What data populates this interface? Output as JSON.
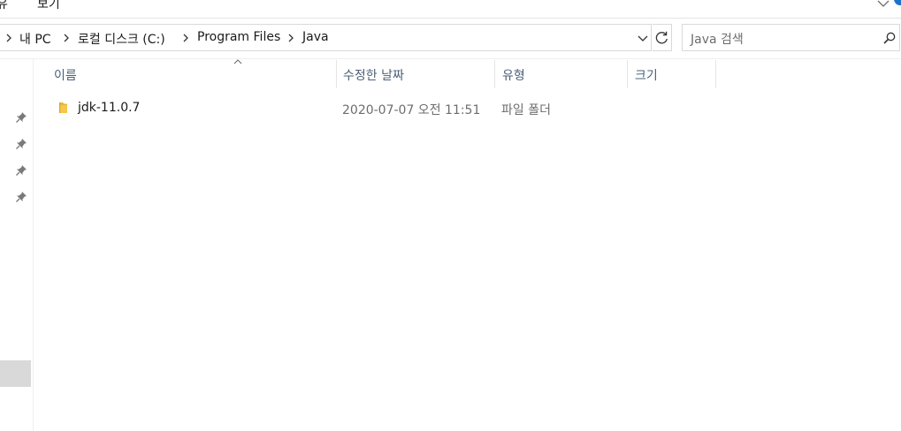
{
  "ribbon": {
    "tab_share": "유",
    "tab_view": "보기"
  },
  "address": {
    "crumbs": [
      {
        "label": "내 PC"
      },
      {
        "label": "로컬 디스크 (C:)"
      },
      {
        "label": "Program Files"
      },
      {
        "label": "Java"
      }
    ]
  },
  "search": {
    "placeholder": "Java 검색"
  },
  "columns": {
    "name": "이름",
    "date": "수정한 날짜",
    "type": "유형",
    "size": "크기"
  },
  "files": [
    {
      "name": "jdk-11.0.7",
      "date": "2020-07-07 오전 11:51",
      "type": "파일 폴더",
      "size": "",
      "icon": "folder-icon"
    }
  ],
  "colors": {
    "accent": "#1a73c8",
    "folder": "#f5c84c",
    "header_text": "#4c607a"
  }
}
